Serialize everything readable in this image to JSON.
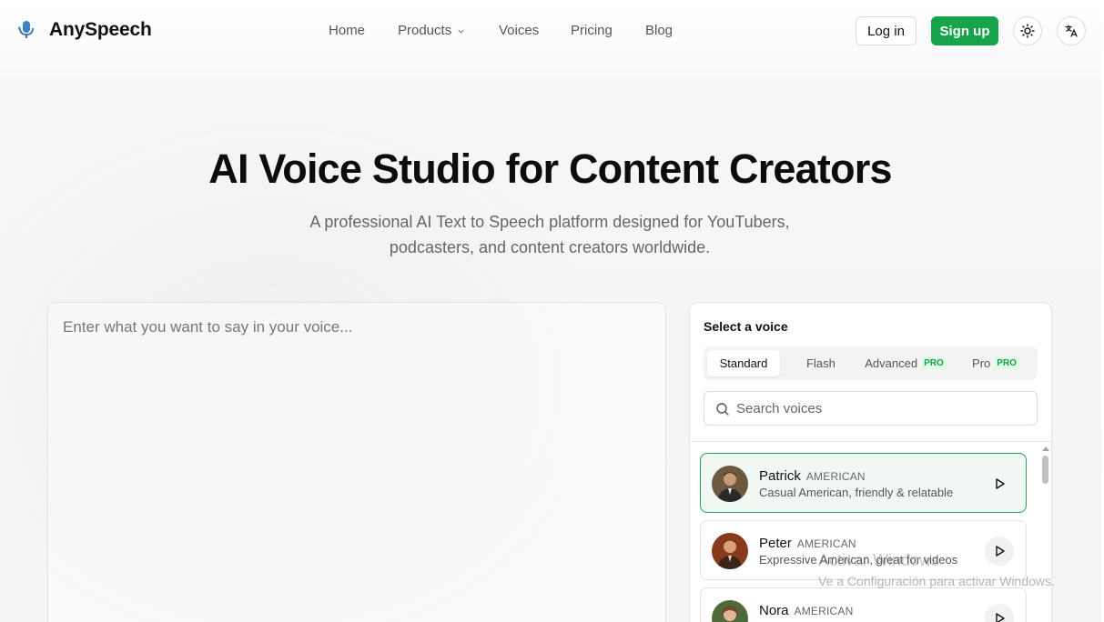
{
  "brand": {
    "name": "AnySpeech",
    "accent": "#16a34a"
  },
  "nav": {
    "items": [
      {
        "label": "Home"
      },
      {
        "label": "Products"
      },
      {
        "label": "Voices"
      },
      {
        "label": "Pricing"
      },
      {
        "label": "Blog"
      }
    ],
    "login_label": "Log in",
    "signup_label": "Sign up",
    "theme_icon": "sun-icon",
    "language_icon": "translate-icon"
  },
  "hero": {
    "title": "AI Voice Studio for Content Creators",
    "subtitle": "A professional AI Text to Speech platform designed for YouTubers, podcasters, and content creators worldwide."
  },
  "editor": {
    "placeholder": "Enter what you want to say in your voice...",
    "value": ""
  },
  "voice_panel": {
    "title": "Select a voice",
    "tabs": [
      {
        "label": "Standard",
        "active": true,
        "badge": ""
      },
      {
        "label": "Flash",
        "active": false,
        "badge": ""
      },
      {
        "label": "Advanced",
        "active": false,
        "badge": "PRO"
      },
      {
        "label": "Pro",
        "active": false,
        "badge": "PRO"
      }
    ],
    "search_placeholder": "Search voices",
    "voices": [
      {
        "name": "Patrick",
        "accent": "AMERICAN",
        "description": "Casual American, friendly & relatable",
        "selected": true
      },
      {
        "name": "Peter",
        "accent": "AMERICAN",
        "description": "Expressive American, great for videos",
        "selected": false
      },
      {
        "name": "Nora",
        "accent": "AMERICAN",
        "description": "",
        "selected": false
      }
    ]
  },
  "watermark": {
    "line1": "Activar Windows",
    "line2": "Ve a Configuración para activar Windows."
  }
}
